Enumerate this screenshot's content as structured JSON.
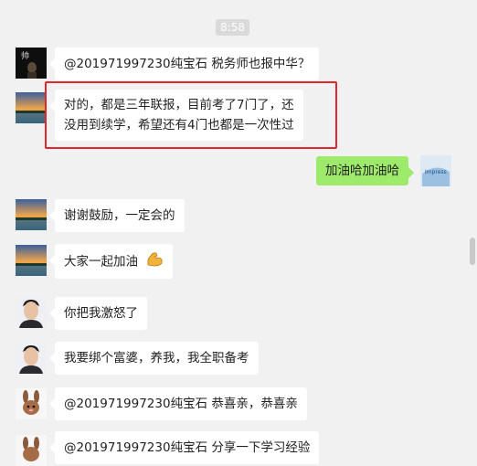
{
  "chat": {
    "timestamp": "8:58",
    "messages": [
      {
        "sender_avatar": "avatar-dark-portrait",
        "side": "left",
        "text": "@201971997230纯宝石 税务师也报中华？"
      },
      {
        "sender_avatar": "avatar-sunset-lake",
        "side": "left",
        "text_line1": "对的，都是三年联报，目前考了7门了，还",
        "text_line2": "没用到续学，希望还有4门也都是一次性过"
      },
      {
        "sender_avatar": "avatar-blue-logo",
        "side": "right",
        "text": "加油哈加油哈"
      },
      {
        "sender_avatar": "avatar-sunset-lake",
        "side": "left",
        "text": "谢谢鼓励，一定会的"
      },
      {
        "sender_avatar": "avatar-sunset-lake",
        "side": "left",
        "text": "大家一起加油",
        "emoji": "flexed-biceps-emoji"
      },
      {
        "sender_avatar": "avatar-young-man",
        "side": "left",
        "text": "你把我激怒了"
      },
      {
        "sender_avatar": "avatar-young-man",
        "side": "left",
        "text": "我要绑个富婆，养我，我全职备考"
      },
      {
        "sender_avatar": "avatar-cartoon-rabbit",
        "side": "left",
        "text": "@201971997230纯宝石 恭喜亲，恭喜亲"
      },
      {
        "sender_avatar": "avatar-cartoon-rabbit",
        "side": "left",
        "text": "@201971997230纯宝石 分享一下学习经验"
      }
    ]
  },
  "colors": {
    "background": "#f1f1f1",
    "bubble_left": "#ffffff",
    "bubble_right": "#9eea6a",
    "highlight": "#e0282c"
  }
}
